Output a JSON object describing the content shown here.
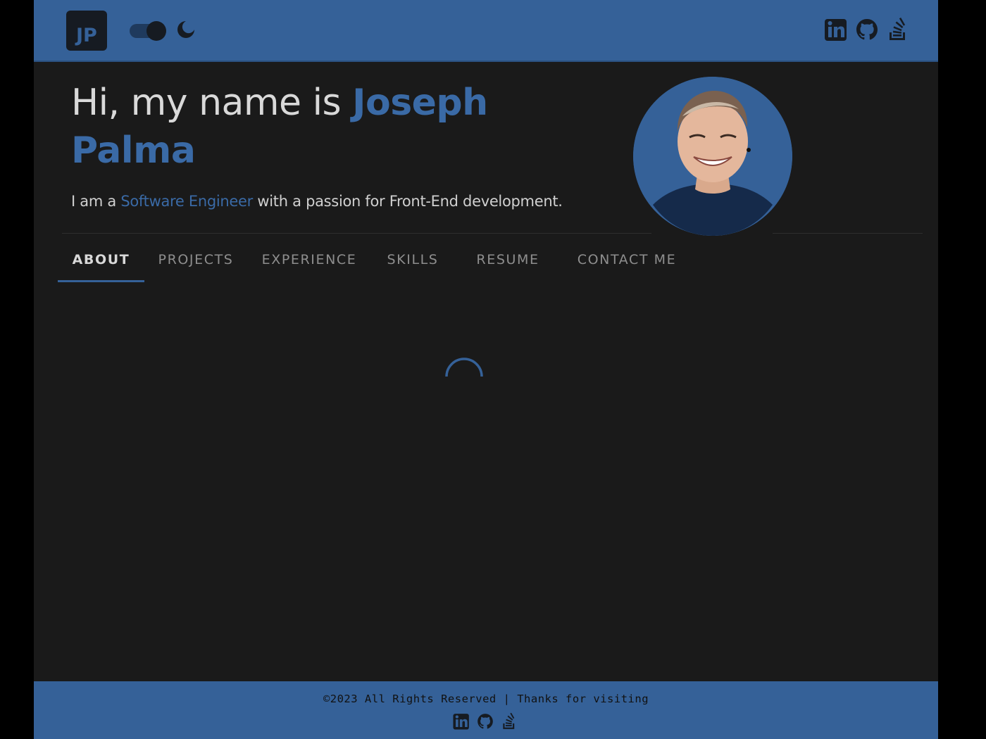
{
  "header": {
    "logo_text": "JP",
    "theme_toggle": "dark-mode-toggle",
    "theme_icon": "moon-icon",
    "social": [
      {
        "name": "linkedin-icon"
      },
      {
        "name": "github-icon"
      },
      {
        "name": "stackoverflow-icon"
      }
    ]
  },
  "hero": {
    "greeting": "Hi, my name is ",
    "name": "Joseph Palma",
    "sub_prefix": "I am a ",
    "role": "Software Engineer",
    "sub_suffix": " with a passion for Front-End development."
  },
  "tabs": [
    {
      "label": "ABOUT",
      "active": true
    },
    {
      "label": "PROJECTS",
      "active": false
    },
    {
      "label": "EXPERIENCE",
      "active": false
    },
    {
      "label": "SKILLS",
      "active": false
    },
    {
      "label": "RESUME",
      "active": false
    },
    {
      "label": "CONTACT ME",
      "active": false
    }
  ],
  "footer": {
    "text": "©2023 All Rights Reserved | Thanks for visiting"
  },
  "colors": {
    "accent": "#356198",
    "accent_text": "#3a6aa6",
    "background": "#1a1a1a",
    "outer": "#000000"
  }
}
